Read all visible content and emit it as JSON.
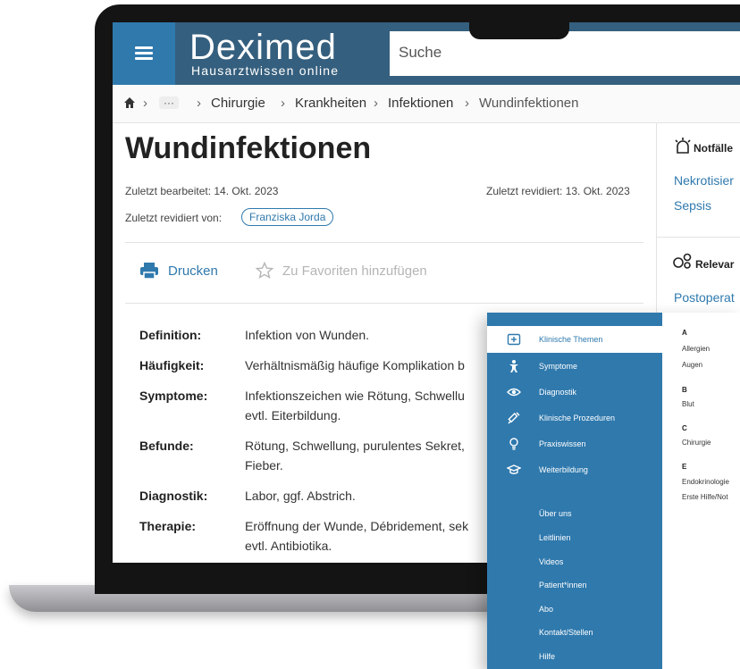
{
  "header": {
    "logo_title": "Deximed",
    "logo_subtitle": "Hausarztwissen online",
    "search_placeholder": "Suche"
  },
  "breadcrumb": {
    "more": "···",
    "items": [
      "Chirurgie",
      "Krankheiten",
      "Infektionen"
    ],
    "current": "Wundinfektionen",
    "separator": "›"
  },
  "article": {
    "title": "Wundinfektionen",
    "last_edited": "Zuletzt bearbeitet: 14. Okt. 2023",
    "last_revised": "Zuletzt revidiert: 13. Okt. 2023",
    "revised_by_label": "Zuletzt revidiert von:",
    "revised_by": "Franziska Jorda",
    "print_label": "Drucken",
    "favorite_label": "Zu Favoriten hinzufügen",
    "rows": [
      {
        "label": "Definition:",
        "value": "Infektion von Wunden."
      },
      {
        "label": "Häufigkeit:",
        "value": "Verhältnismäßig häufige Komplikation b"
      },
      {
        "label": "Symptome:",
        "value": "Infektionszeichen wie Rötung, Schwellu",
        "value2": "evtl. Eiterbildung."
      },
      {
        "label": "Befunde:",
        "value": "Rötung, Schwellung, purulentes Sekret,",
        "value2": "Fieber."
      },
      {
        "label": "Diagnostik:",
        "value": "Labor, ggf. Abstrich."
      },
      {
        "label": "Therapie:",
        "value": "Eröffnung der Wunde, Débridement, sek",
        "value2": "evtl. Antibiotika."
      }
    ]
  },
  "sidebar": {
    "notfaelle_heading": "Notfälle",
    "notfaelle_links": [
      "Nekrotisier",
      "Sepsis"
    ],
    "relevant_heading": "Relevar",
    "relevant_links": [
      "Postoperat"
    ]
  },
  "overlay_menu": {
    "items": [
      {
        "label": "Klinische Themen",
        "icon": "plus-square-icon",
        "active": true
      },
      {
        "label": "Symptome",
        "icon": "person-icon"
      },
      {
        "label": "Diagnostik",
        "icon": "eye-icon"
      },
      {
        "label": "Klinische Prozeduren",
        "icon": "syringe-icon"
      },
      {
        "label": "Praxiswissen",
        "icon": "lightbulb-icon"
      },
      {
        "label": "Weiterbildung",
        "icon": "graduation-cap-icon"
      }
    ],
    "links": [
      "Über uns",
      "Leitlinien",
      "Videos",
      "Patient*innen",
      "Abo",
      "Kontakt/Stellen",
      "Hilfe"
    ],
    "index": [
      {
        "letter": "A",
        "items": [
          "Allergien",
          "Augen"
        ]
      },
      {
        "letter": "B",
        "items": [
          "Blut"
        ]
      },
      {
        "letter": "C",
        "items": [
          "Chirurgie"
        ]
      },
      {
        "letter": "E",
        "items": [
          "Endokrinologie",
          "Erste Hilfe/Not"
        ]
      }
    ]
  },
  "colors": {
    "brand_blue": "#2f79ad",
    "header_dark": "#355f7e"
  }
}
